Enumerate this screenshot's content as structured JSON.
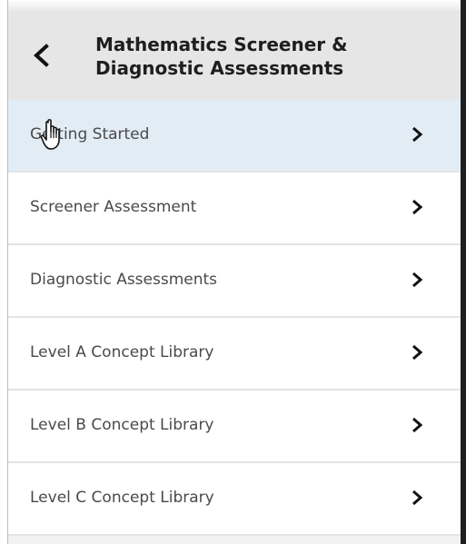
{
  "header": {
    "title_line1": "Mathematics Screener &",
    "title_line2": "Diagnostic Assessments",
    "back_icon": "chevron-left-icon"
  },
  "menu": {
    "items": [
      {
        "label": "Getting Started",
        "active": true
      },
      {
        "label": "Screener Assessment",
        "active": false
      },
      {
        "label": "Diagnostic Assessments",
        "active": false
      },
      {
        "label": "Level A Concept Library",
        "active": false
      },
      {
        "label": "Level B Concept Library",
        "active": false
      },
      {
        "label": "Level C Concept Library",
        "active": false
      }
    ],
    "item_icon": "chevron-right-icon"
  },
  "cursor": {
    "icon": "hand-pointer-icon"
  },
  "colors": {
    "header_bg": "#e6e6e6",
    "active_bg": "#e2ecf4",
    "item_text": "#4a4a4a",
    "title_text": "#1e1e1e"
  }
}
